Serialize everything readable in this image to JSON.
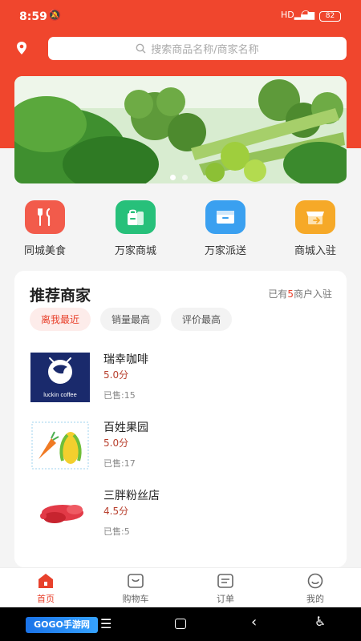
{
  "status": {
    "time": "8:59",
    "battery": "82",
    "signal": "HD"
  },
  "search": {
    "placeholder": "搜索商品名称/商家名称"
  },
  "banner": {
    "slides": 2,
    "active_index": 0
  },
  "categories": [
    {
      "label": "同城美食",
      "icon": "fork-knife-icon",
      "color": "#f25b4b"
    },
    {
      "label": "万家商城",
      "icon": "shopping-bag-icon",
      "color": "#27c07a"
    },
    {
      "label": "万家派送",
      "icon": "delivery-box-icon",
      "color": "#3aa0f0"
    },
    {
      "label": "商城入驻",
      "icon": "storefront-icon",
      "color": "#f6a928"
    }
  ],
  "recommend": {
    "title": "推荐商家",
    "count_prefix": "已有",
    "count_num": "5",
    "count_suffix": "商户入驻",
    "filters": [
      "离我最近",
      "销量最高",
      "评价最高"
    ],
    "shops": [
      {
        "name": "瑞幸咖啡",
        "rating": "5.0分",
        "sold": "已售:15",
        "logo_text": "luckin coffee"
      },
      {
        "name": "百姓果园",
        "rating": "5.0分",
        "sold": "已售:17"
      },
      {
        "name": "三胖粉丝店",
        "rating": "4.5分",
        "sold": "已售:5"
      }
    ]
  },
  "tabs": [
    {
      "label": "首页",
      "icon": "home-icon"
    },
    {
      "label": "购物车",
      "icon": "cart-icon"
    },
    {
      "label": "订单",
      "icon": "order-icon"
    },
    {
      "label": "我的",
      "icon": "profile-icon"
    }
  ],
  "colors": {
    "accent": "#f0462d",
    "rating": "#b8402e"
  },
  "navbar": {
    "brand": "GOGO手游网"
  }
}
